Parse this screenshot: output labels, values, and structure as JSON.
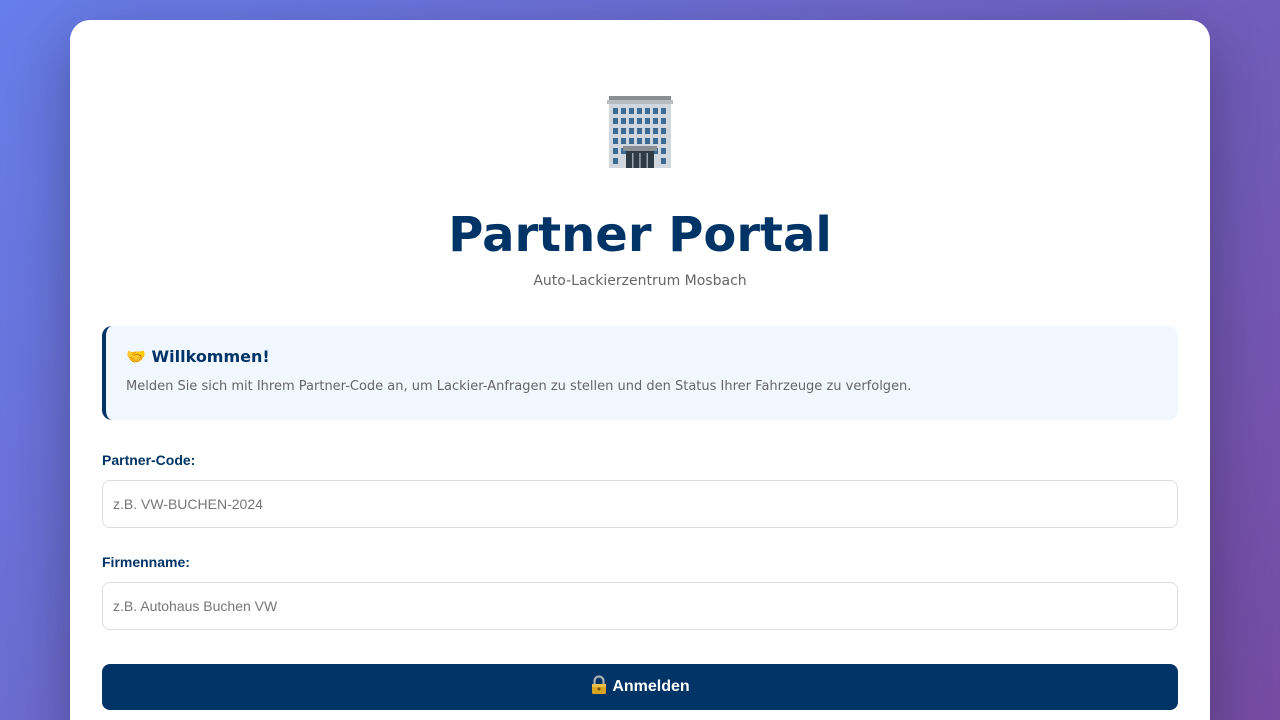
{
  "header": {
    "logo_icon": "office-building-icon",
    "title": "Partner Portal",
    "subtitle": "Auto-Lackierzentrum Mosbach"
  },
  "welcome": {
    "icon": "handshake-icon",
    "title_icon_text": "🤝",
    "title": "Willkommen!",
    "text": "Melden Sie sich mit Ihrem Partner-Code an, um Lackier-Anfragen zu stellen und den Status Ihrer Fahrzeuge zu verfolgen."
  },
  "form": {
    "partner_code": {
      "label": "Partner-Code:",
      "value": "",
      "placeholder": "z.B. VW-BUCHEN-2024"
    },
    "company_name": {
      "label": "Firmenname:",
      "value": "",
      "placeholder": "z.B. Autohaus Buchen VW"
    },
    "submit": {
      "icon": "lock-icon",
      "label": "Anmelden"
    }
  },
  "colors": {
    "primary": "#003366",
    "background_gradient_start": "#667eea",
    "background_gradient_end": "#764ba2",
    "info_background": "#f0f7ff"
  }
}
